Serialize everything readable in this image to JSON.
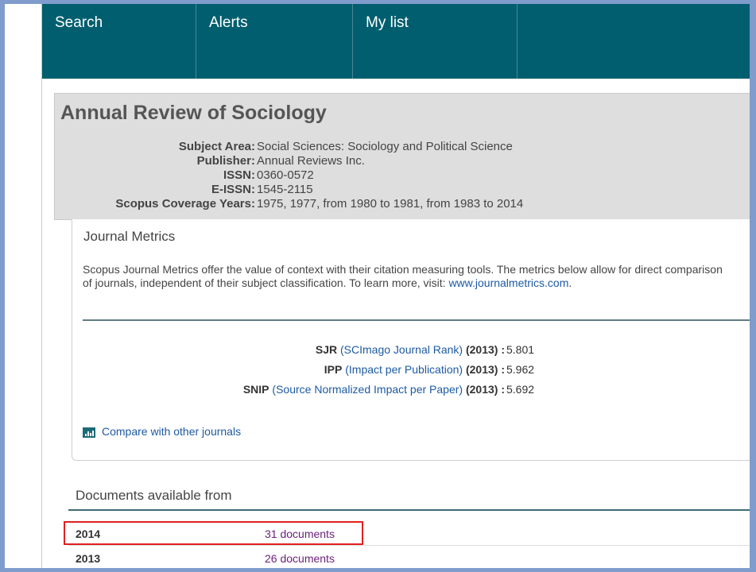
{
  "nav": {
    "tabs": [
      {
        "label": "Search"
      },
      {
        "label": "Alerts"
      },
      {
        "label": "My list"
      }
    ]
  },
  "journal": {
    "title": "Annual Review of Sociology",
    "info": [
      {
        "label": "Subject Area:",
        "value": "Social Sciences: Sociology and Political Science"
      },
      {
        "label": "Publisher:",
        "value": "Annual Reviews Inc."
      },
      {
        "label": "ISSN:",
        "value": "0360-0572"
      },
      {
        "label": "E-ISSN:",
        "value": "1545-2115"
      },
      {
        "label": "Scopus Coverage Years:",
        "value": "1975, 1977, from 1980 to 1981, from 1983 to 2014"
      }
    ]
  },
  "metrics": {
    "title": "Journal Metrics",
    "description": "Scopus Journal Metrics offer the value of context with their citation measuring tools. The metrics below allow for direct comparison of journals, independent of their subject classification. To learn more, visit: ",
    "link_text": "www.journalmetrics.com",
    "link_suffix": ".",
    "rows": [
      {
        "abbr": "SJR",
        "name": "(SCImago Journal Rank)",
        "year": "(2013) :",
        "value": "5.801"
      },
      {
        "abbr": "IPP",
        "name": "(Impact per Publication)",
        "year": "(2013) :",
        "value": "5.962"
      },
      {
        "abbr": "SNIP",
        "name": "(Source Normalized Impact per Paper)",
        "year": "(2013) :",
        "value": "5.692"
      }
    ],
    "compare_label": "Compare with other journals"
  },
  "documents": {
    "title": "Documents available from",
    "rows": [
      {
        "year": "2014",
        "count": "31 documents"
      },
      {
        "year": "2013",
        "count": "26 documents"
      }
    ]
  },
  "colors": {
    "nav_bg": "#005e6e",
    "highlight": "#e02020",
    "link": "#1d5aa3",
    "visited_link": "#6b1d7a"
  }
}
